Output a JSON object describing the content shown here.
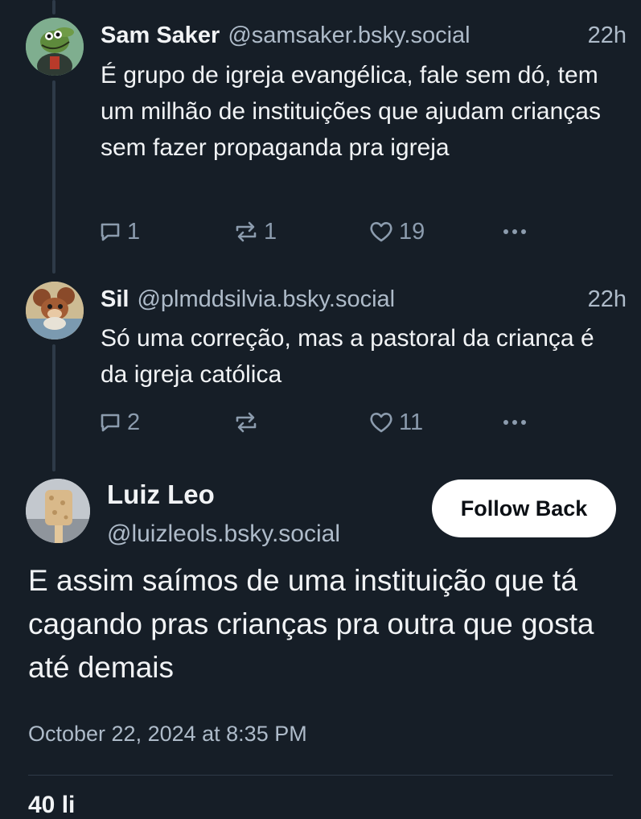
{
  "posts": [
    {
      "author": "Sam Saker",
      "handle": "@samsaker.bsky.social",
      "time": "22h",
      "text": "É grupo de igreja evangélica, fale sem dó, tem um milhão de instituições que ajudam crianças sem fazer propaganda pra igreja",
      "replies": "1",
      "reposts": "1",
      "likes": "19",
      "avatar_icon": "alligator-avatar"
    },
    {
      "author": "Sil",
      "handle": "@plmddsilvia.bsky.social",
      "time": "22h",
      "text": "Só uma correção, mas a pastoral da criança é da igreja católica",
      "replies": "2",
      "reposts": "",
      "likes": "11",
      "avatar_icon": "cartoon-mouse-avatar"
    }
  ],
  "main_post": {
    "author": "Luiz Leo",
    "handle": "@luizleols.bsky.social",
    "follow_label": "Follow Back",
    "text": "E assim saímos de uma instituição que tá cagando pras crianças pra outra que gosta até demais",
    "date": "October 22, 2024 at 8:35 PM",
    "cutoff_text": "40 li",
    "avatar_icon": "bread-snack-avatar"
  },
  "colors": {
    "background": "#161e27",
    "text": "#f1f3f5",
    "muted": "#aebbc9",
    "icon": "#8c9cae"
  }
}
